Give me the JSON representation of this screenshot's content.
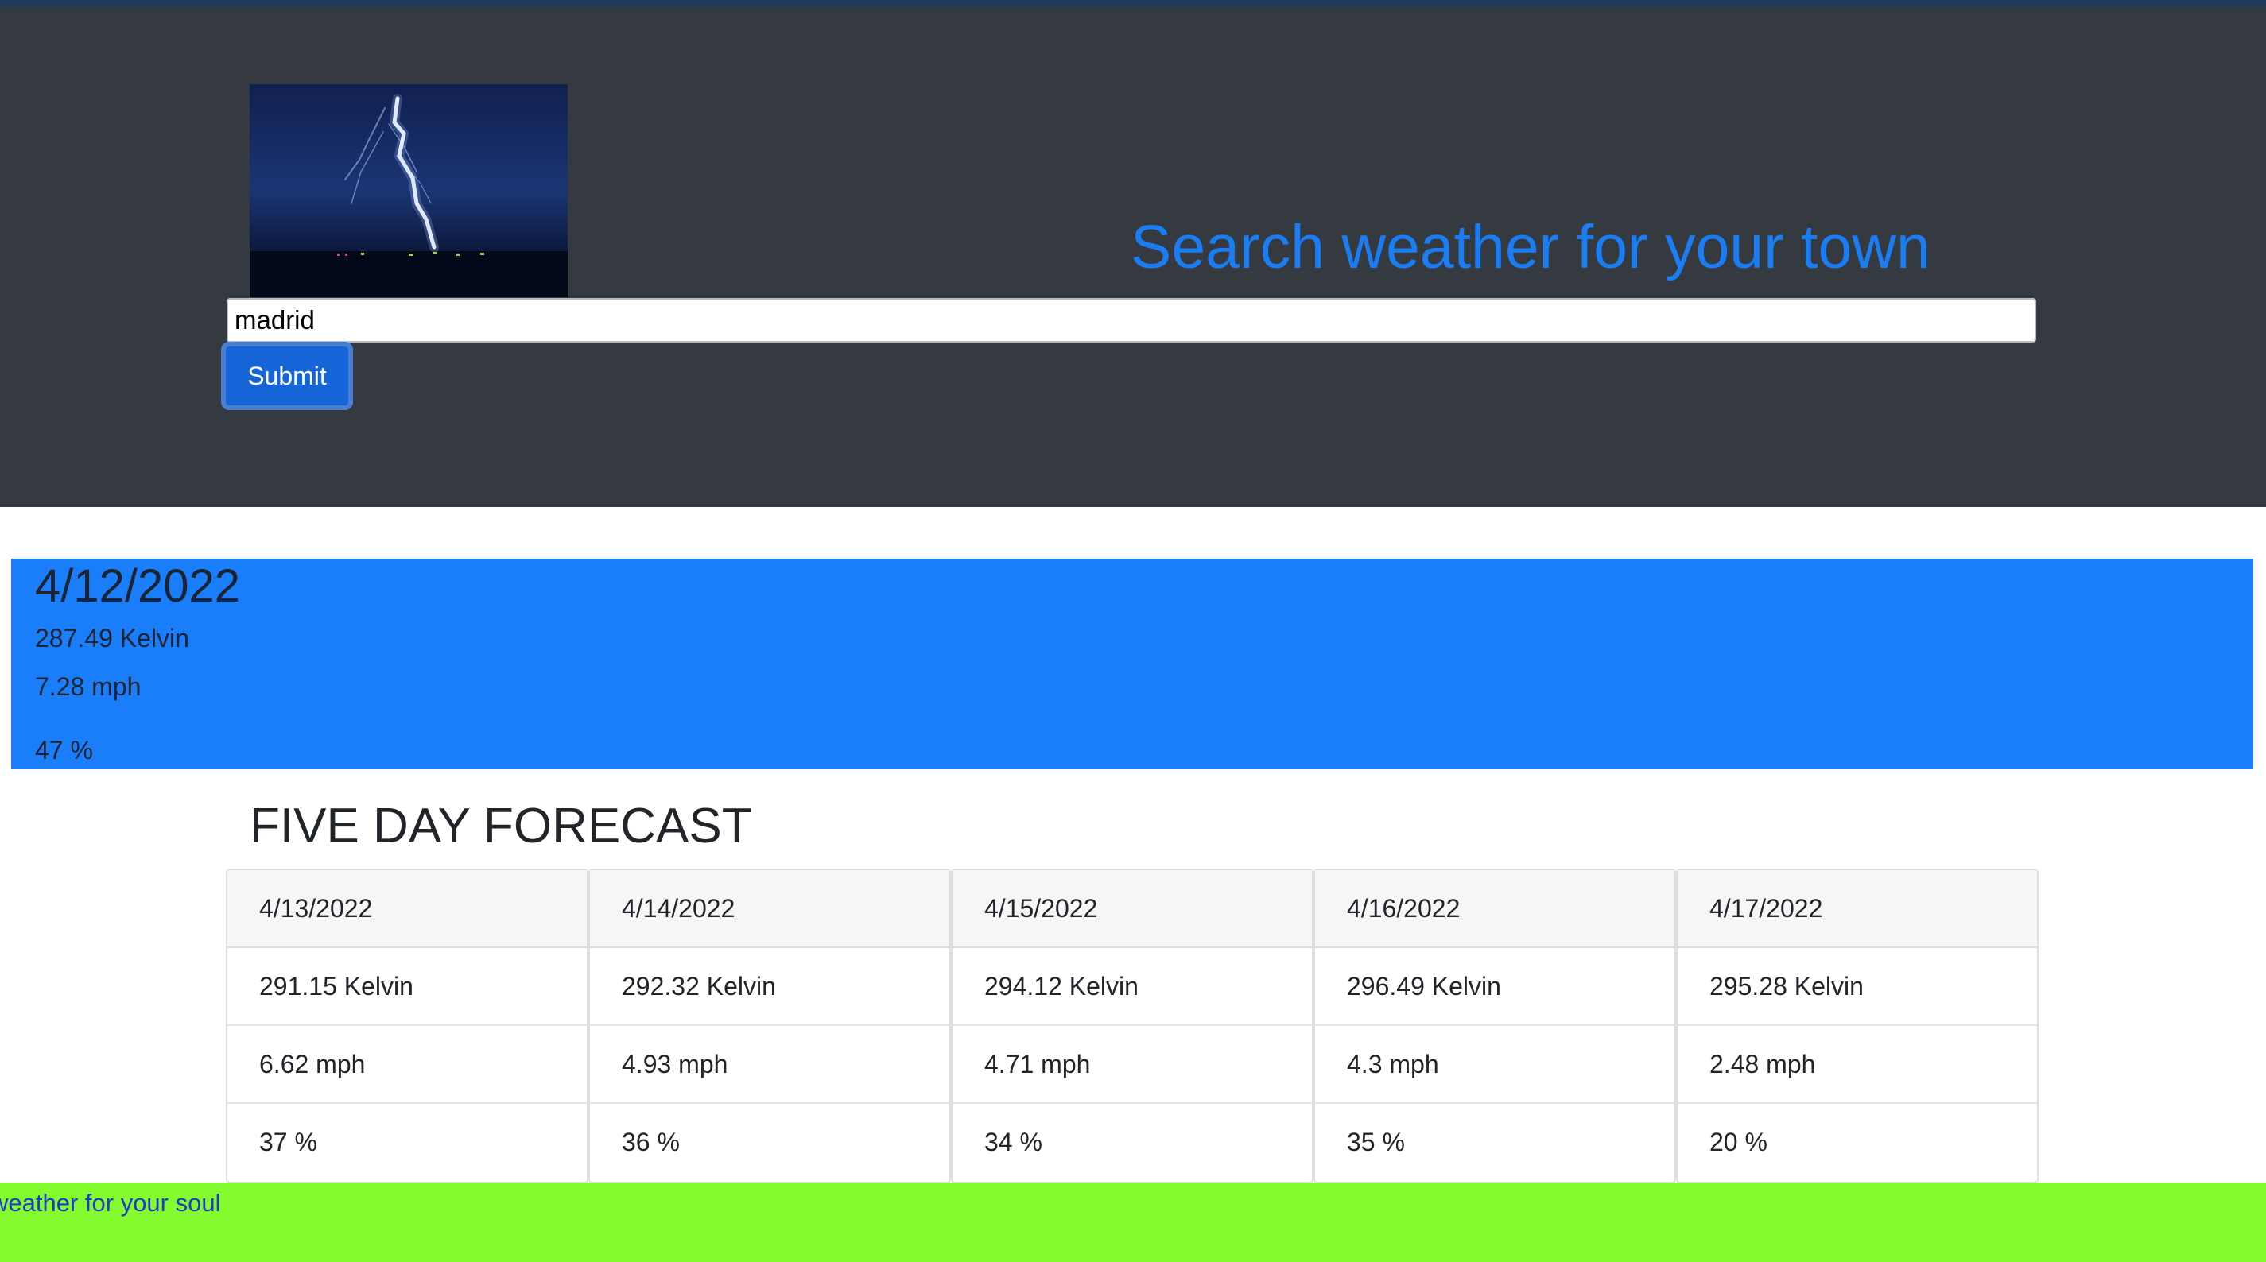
{
  "header": {
    "title": "Search weather for your town",
    "image_subject": "lightning storm photo"
  },
  "search": {
    "value": "madrid",
    "submit_label": "Submit"
  },
  "current": {
    "date": "4/12/2022",
    "temperature": "287.49 Kelvin",
    "wind": "7.28 mph",
    "humidity": "47 %"
  },
  "forecast": {
    "heading": "FIVE DAY FORECAST",
    "days": [
      {
        "date": "4/13/2022",
        "temperature": "291.15 Kelvin",
        "wind": "6.62 mph",
        "humidity": "37 %"
      },
      {
        "date": "4/14/2022",
        "temperature": "292.32 Kelvin",
        "wind": "4.93 mph",
        "humidity": "36 %"
      },
      {
        "date": "4/15/2022",
        "temperature": "294.12 Kelvin",
        "wind": "4.71 mph",
        "humidity": "34 %"
      },
      {
        "date": "4/16/2022",
        "temperature": "296.49 Kelvin",
        "wind": "4.3 mph",
        "humidity": "35 %"
      },
      {
        "date": "4/17/2022",
        "temperature": "295.28 Kelvin",
        "wind": "2.48 mph",
        "humidity": "20 %"
      }
    ]
  },
  "footer": {
    "text": "weather for your soul"
  },
  "colors": {
    "hero_bg": "#353a41",
    "title_blue": "#1a7df3",
    "today_bg": "#1a7df9",
    "button_bg": "#1565d8",
    "footer_bg": "#84fb2f",
    "footer_text": "#1c3cc7"
  }
}
